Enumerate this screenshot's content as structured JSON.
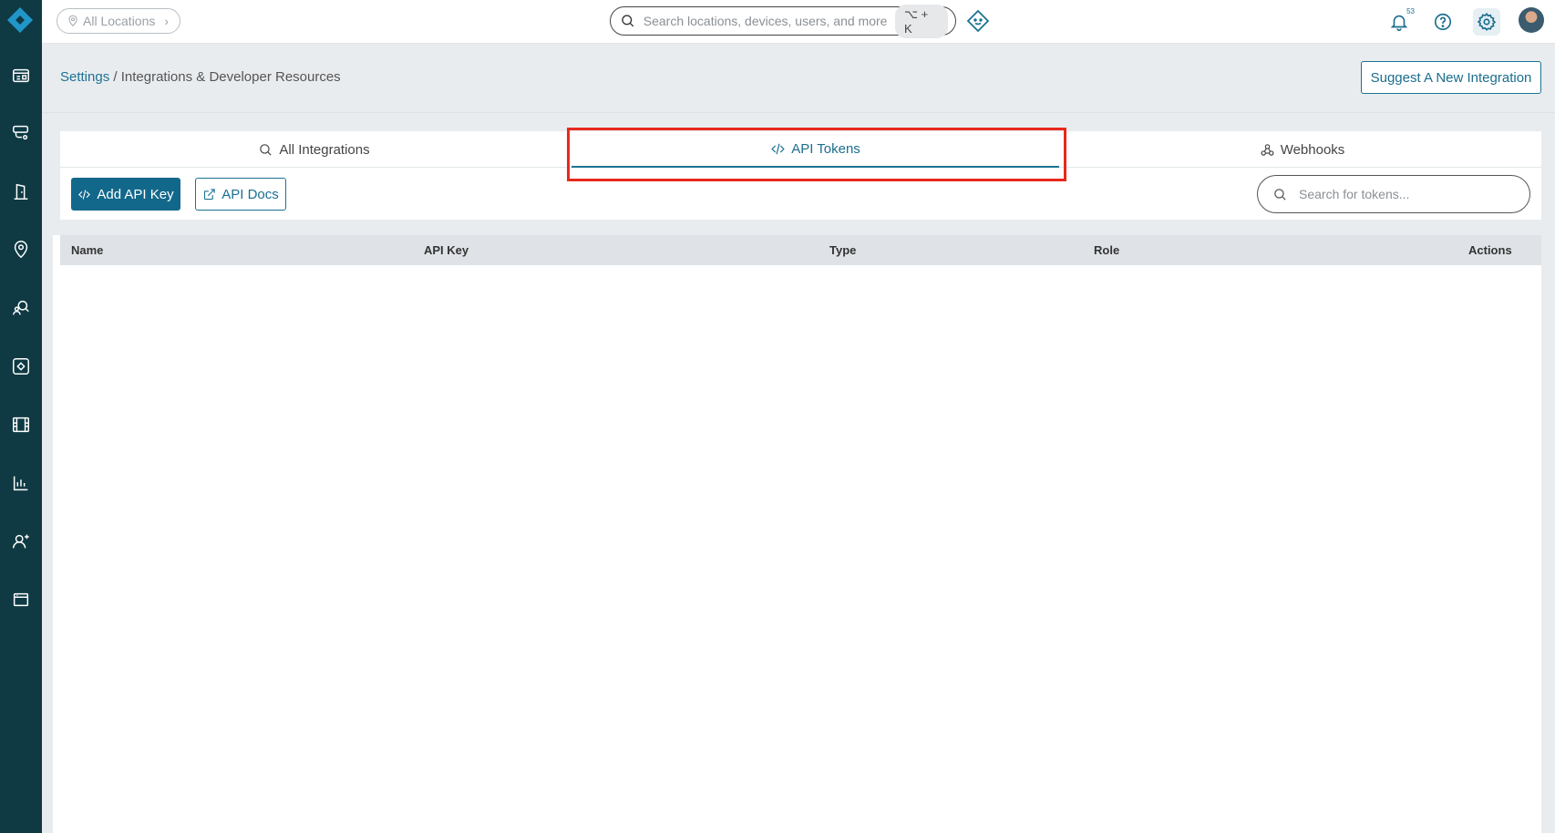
{
  "sidebar": {
    "items": [
      {
        "name": "dashboard-icon"
      },
      {
        "name": "cameras-icon"
      },
      {
        "name": "access-door-icon"
      },
      {
        "name": "location-pin-icon"
      },
      {
        "name": "people-search-icon"
      },
      {
        "name": "integrations-icon"
      },
      {
        "name": "video-wall-icon"
      },
      {
        "name": "analytics-icon"
      },
      {
        "name": "add-user-icon"
      },
      {
        "name": "window-icon"
      }
    ]
  },
  "topbar": {
    "location_label": "All Locations",
    "search_placeholder": "Search locations, devices, users, and more",
    "shortcut": "⌥ + K",
    "notification_count": "53"
  },
  "header": {
    "breadcrumb_link": "Settings",
    "breadcrumb_separator": " / ",
    "breadcrumb_current": "Integrations & Developer Resources",
    "suggest_button": "Suggest A New Integration"
  },
  "tabs": {
    "all": "All Integrations",
    "api": "API Tokens",
    "webhooks": "Webhooks",
    "active": "api"
  },
  "toolbar": {
    "add_key": "Add API Key",
    "docs": "API Docs",
    "search_placeholder": "Search for tokens..."
  },
  "table": {
    "columns": [
      "Name",
      "API Key",
      "Type",
      "Role",
      "Actions"
    ],
    "rows": []
  },
  "colors": {
    "sidebar": "#0f3a44",
    "accent": "#1b7393",
    "highlight": "#e8281c"
  }
}
